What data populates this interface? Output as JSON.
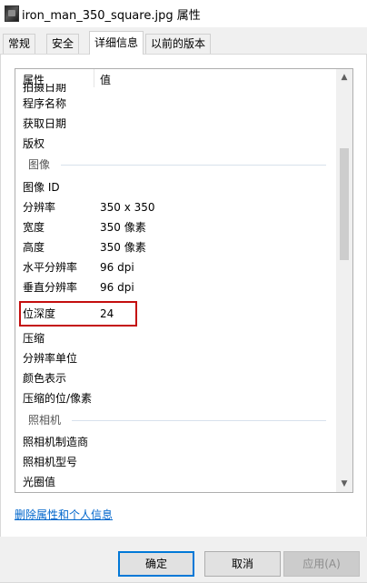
{
  "window": {
    "title": "iron_man_350_square.jpg 属性"
  },
  "tabs": [
    {
      "label": "常规"
    },
    {
      "label": "安全"
    },
    {
      "label": "详细信息"
    },
    {
      "label": "以前的版本"
    }
  ],
  "details": {
    "columns": {
      "property": "属性",
      "value": "值"
    },
    "partial_row": "拍摄日期",
    "origin_rows": [
      {
        "name": "程序名称",
        "value": ""
      },
      {
        "name": "获取日期",
        "value": ""
      },
      {
        "name": "版权",
        "value": ""
      }
    ],
    "image_group": "图像",
    "image_rows": [
      {
        "name": "图像 ID",
        "value": ""
      },
      {
        "name": "分辨率",
        "value": "350 x 350"
      },
      {
        "name": "宽度",
        "value": "350 像素"
      },
      {
        "name": "高度",
        "value": "350 像素"
      },
      {
        "name": "水平分辨率",
        "value": "96 dpi"
      },
      {
        "name": "垂直分辨率",
        "value": "96 dpi"
      },
      {
        "name": "位深度",
        "value": "24"
      },
      {
        "name": "压缩",
        "value": ""
      },
      {
        "name": "分辨率单位",
        "value": ""
      },
      {
        "name": "颜色表示",
        "value": ""
      },
      {
        "name": "压缩的位/像素",
        "value": ""
      }
    ],
    "camera_group": "照相机",
    "camera_rows": [
      {
        "name": "照相机制造商",
        "value": ""
      },
      {
        "name": "照相机型号",
        "value": ""
      },
      {
        "name": "光圈值",
        "value": ""
      }
    ]
  },
  "highlight_color": "#c40e0e",
  "link": "删除属性和个人信息",
  "buttons": {
    "ok": "确定",
    "cancel": "取消",
    "apply": "应用(A)"
  }
}
